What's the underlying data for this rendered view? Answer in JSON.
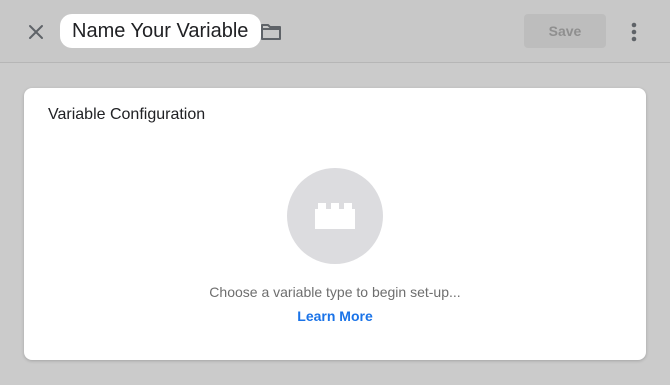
{
  "header": {
    "variable_name": "Name Your Variable",
    "save_label": "Save",
    "close_icon": "close-icon",
    "folder_icon": "folder-icon",
    "more_icon": "more-vert-icon"
  },
  "config": {
    "title": "Variable Configuration",
    "type_icon": "block-icon",
    "prompt": "Choose a variable type to begin set-up...",
    "learn_more": "Learn More"
  },
  "colors": {
    "accent": "#1a73e8",
    "overlay": "#cbcbcb",
    "disabled_button": "#bdbdbd"
  }
}
